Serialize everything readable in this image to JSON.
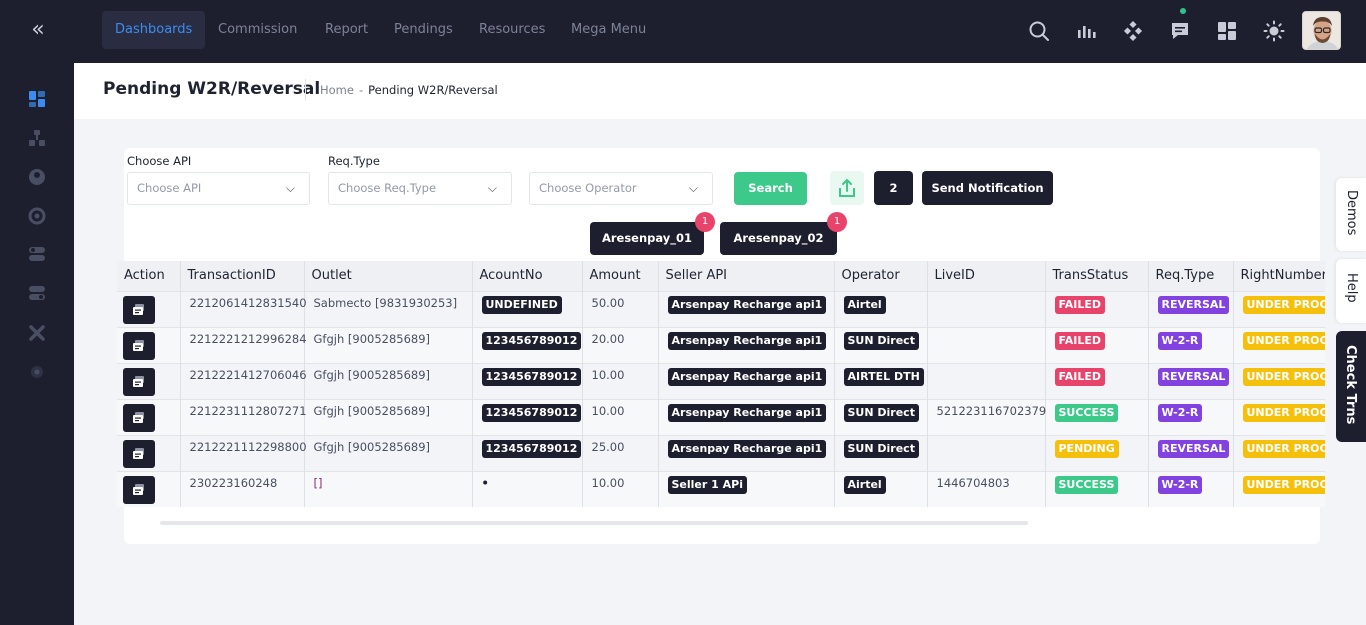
{
  "nav": {
    "items": [
      {
        "label": "Dashboards",
        "active": true
      },
      {
        "label": "Commission"
      },
      {
        "label": "Report"
      },
      {
        "label": "Pendings"
      },
      {
        "label": "Resources"
      },
      {
        "label": "Mega Menu"
      }
    ],
    "icons": [
      "search-icon",
      "chart-icon",
      "apps-icon",
      "chat-icon",
      "grid-icon",
      "sun-icon"
    ]
  },
  "sidebar": {
    "icons": [
      "dashboard-icon",
      "tree-icon",
      "user-icon",
      "support-icon",
      "toggle-icon",
      "toggle-alt-icon",
      "tools-icon",
      "settings-icon"
    ]
  },
  "header": {
    "title": "Pending W2R/Reversal",
    "breadcrumb": {
      "home": "Home",
      "separator": "-",
      "current": "Pending W2R/Reversal"
    }
  },
  "filters": {
    "api_label": "Choose API",
    "api_placeholder": "Choose API",
    "reqtype_label": "Req.Type",
    "reqtype_placeholder": "Choose Req.Type",
    "operator_placeholder": "Choose Operator",
    "search_label": "Search",
    "count_label": "2",
    "send_label": "Send Notification"
  },
  "api_chips": [
    {
      "label": "Aresenpay_01",
      "badge": "1"
    },
    {
      "label": "Aresenpay_02",
      "badge": "1"
    }
  ],
  "table": {
    "columns": [
      "Action",
      "TransactionID",
      "Outlet",
      "AcountNo",
      "Amount",
      "Seller API",
      "Operator",
      "LiveID",
      "TransStatus",
      "Req.Type",
      "RightNumber"
    ],
    "rows": [
      {
        "txn": "2212061412831540",
        "outlet": "Sabmecto [9831930253]",
        "account": "UNDEFINED",
        "amount": "50.00",
        "seller": "Arsenpay Recharge api1",
        "operator": "Airtel",
        "live": "",
        "status": "FAILED",
        "req": "REVERSAL",
        "right": "UNDER PROCESS"
      },
      {
        "txn": "2212221212996284",
        "outlet": "Gfgjh [9005285689]",
        "account": "123456789012",
        "amount": "20.00",
        "seller": "Arsenpay Recharge api1",
        "operator": "SUN Direct",
        "live": "",
        "status": "FAILED",
        "req": "W-2-R",
        "right": "UNDER PROCESS"
      },
      {
        "txn": "2212221412706046",
        "outlet": "Gfgjh [9005285689]",
        "account": "123456789012",
        "amount": "10.00",
        "seller": "Arsenpay Recharge api1",
        "operator": "AIRTEL DTH",
        "live": "",
        "status": "FAILED",
        "req": "REVERSAL",
        "right": "UNDER PROCESS"
      },
      {
        "txn": "2212231112807271",
        "outlet": "Gfgjh [9005285689]",
        "account": "123456789012",
        "amount": "10.00",
        "seller": "Arsenpay Recharge api1",
        "operator": "SUN Direct",
        "live": "521223116702379",
        "status": "SUCCESS",
        "req": "W-2-R",
        "right": "UNDER PROCESS"
      },
      {
        "txn": "2212221112298800",
        "outlet": "Gfgjh [9005285689]",
        "account": "123456789012",
        "amount": "25.00",
        "seller": "Arsenpay Recharge api1",
        "operator": "SUN Direct",
        "live": "",
        "status": "PENDING",
        "req": "REVERSAL",
        "right": "UNDER PROCESS"
      },
      {
        "txn": "230223160248",
        "outlet": "[]",
        "account": "•",
        "amount": "10.00",
        "seller": "Seller 1 APi",
        "operator": "Airtel",
        "live": "1446704803",
        "status": "SUCCESS",
        "req": "W-2-R",
        "right": "UNDER PROCESS"
      }
    ]
  },
  "side_tabs": [
    "Demos",
    "Help",
    "Check Trns"
  ],
  "colors": {
    "dark": "#1d1f2e",
    "accent": "#3b8cf0",
    "success": "#3cc98a",
    "failed": "#e8446b",
    "pending": "#f5c00c",
    "reqtype": "#8142df"
  }
}
